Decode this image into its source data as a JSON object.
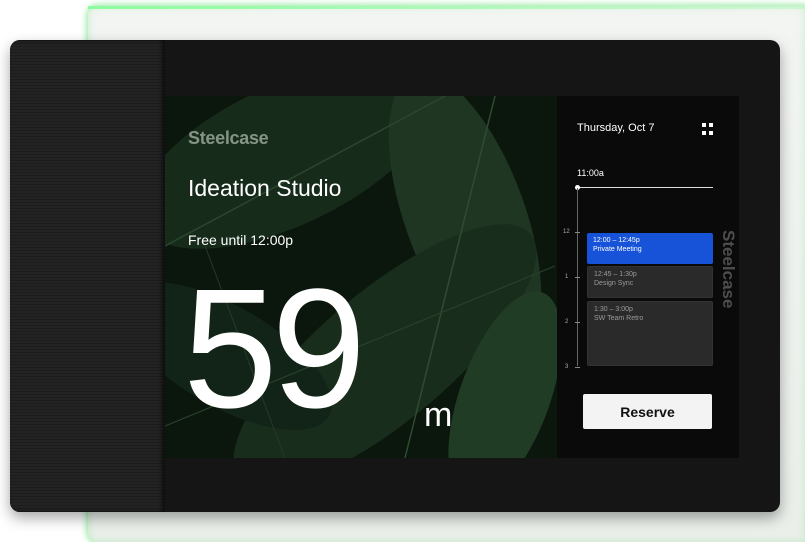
{
  "brand": "Steelcase",
  "room": {
    "name": "Ideation Studio",
    "status": "Free until 12:00p",
    "minutes": "59",
    "unit": "m"
  },
  "calendar": {
    "date": "Thursday, Oct 7",
    "menu_icon": "grid-icon",
    "now_time": "11:00a",
    "hour_ticks": [
      "12",
      "1",
      "2",
      "3"
    ],
    "events": [
      {
        "time": "12:00 – 12:45p",
        "title": "Private Meeting",
        "state": "active"
      },
      {
        "time": "12:45 – 1:30p",
        "title": "Design Sync",
        "state": "upcoming"
      },
      {
        "time": "1:30 – 3:00p",
        "title": "SW Team Retro",
        "state": "upcoming"
      }
    ],
    "reserve_label": "Reserve"
  },
  "colors": {
    "accent": "#1653d9",
    "glow": "#5adc6e",
    "panel": "#0a0a0a"
  }
}
